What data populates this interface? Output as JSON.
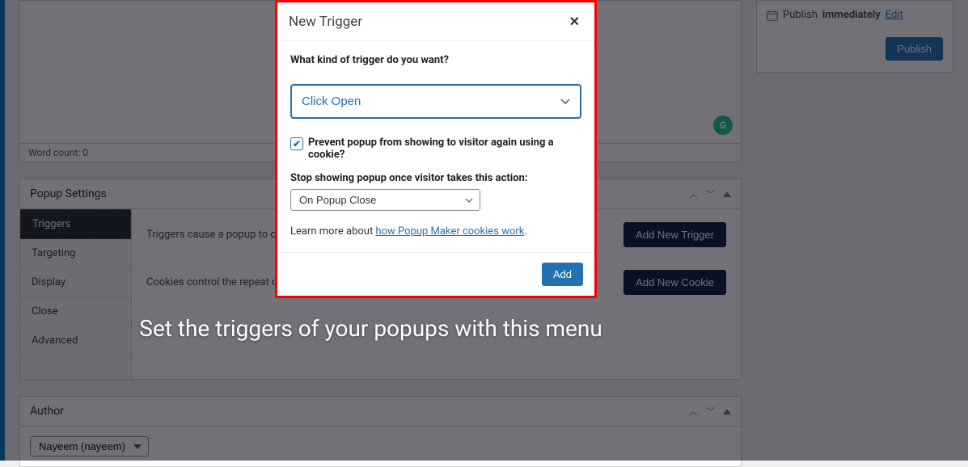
{
  "editor": {
    "word_count_label": "Word count: 0",
    "g_badge": "G"
  },
  "popup_settings": {
    "title": "Popup Settings",
    "tabs": [
      "Triggers",
      "Targeting",
      "Display",
      "Close",
      "Advanced"
    ],
    "triggers_desc": "Triggers cause a popup to open.",
    "cookies_desc": "Cookies control the repeat display of a popup.",
    "add_trigger_btn": "Add New Trigger",
    "add_cookie_btn": "Add New Cookie"
  },
  "author_panel": {
    "title": "Author",
    "selected": "Nayeem (nayeem)"
  },
  "publish_box": {
    "status_prefix": "Publish",
    "status_word": "immediately",
    "edit_link": "Edit",
    "publish_btn": "Publish"
  },
  "modal": {
    "title": "New Trigger",
    "question": "What kind of trigger do you want?",
    "trigger_type_selected": "Click Open",
    "prevent_checkbox_label": "Prevent popup from showing to visitor again using a cookie?",
    "prevent_checked": true,
    "stop_label": "Stop showing popup once visitor takes this action:",
    "stop_action_selected": "On Popup Close",
    "learn_prefix": "Learn more about ",
    "learn_link": "how Popup Maker cookies work",
    "add_btn": "Add"
  },
  "caption": "Set the triggers of your popups with this menu"
}
